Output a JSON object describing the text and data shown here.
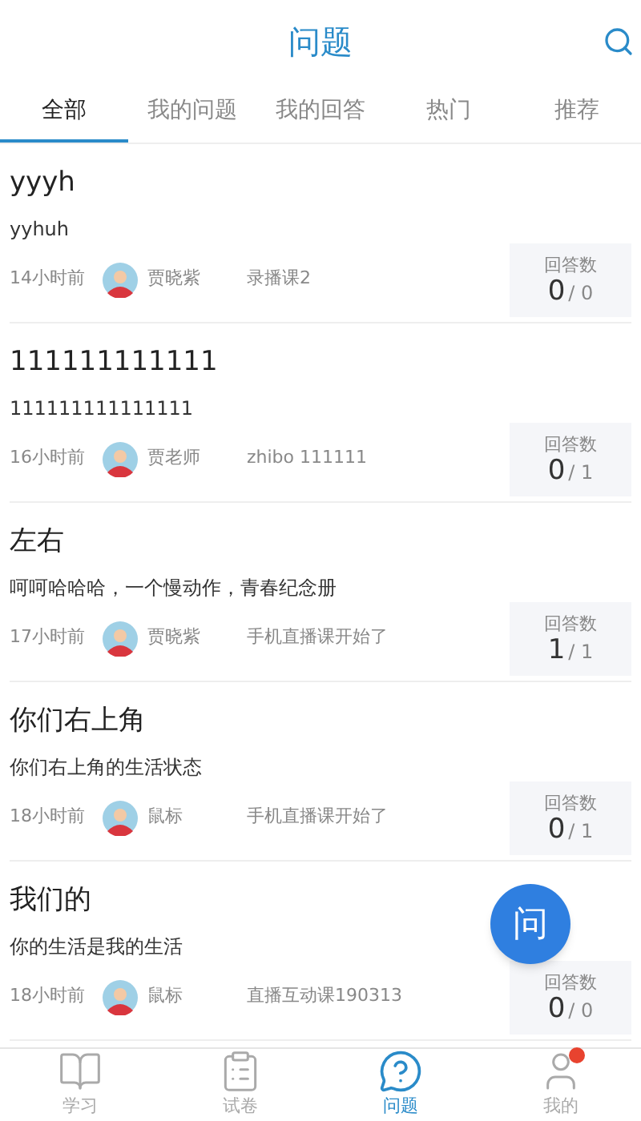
{
  "header": {
    "title": "问题"
  },
  "tabs": [
    {
      "label": "全部",
      "selected": true
    },
    {
      "label": "我的问题",
      "selected": false
    },
    {
      "label": "我的回答",
      "selected": false
    },
    {
      "label": "热门",
      "selected": false
    },
    {
      "label": "推荐",
      "selected": false
    }
  ],
  "questions": [
    {
      "title": "yyyh",
      "body": "yyhuh",
      "time": "14小时前",
      "author": "贾晓紫",
      "course": "录播课2",
      "count_label": "回答数",
      "answered": "0",
      "total": "/ 0"
    },
    {
      "title": "111111111111",
      "body": "111111111111111",
      "time": "16小时前",
      "author": "贾老师",
      "course": "zhibo 111111",
      "count_label": "回答数",
      "answered": "0",
      "total": "/ 1"
    },
    {
      "title": "左右",
      "body": "呵呵哈哈哈，一个慢动作，青春纪念册",
      "time": "17小时前",
      "author": "贾晓紫",
      "course": "手机直播课开始了",
      "count_label": "回答数",
      "answered": "1",
      "total": "/ 1"
    },
    {
      "title": "你们右上角",
      "body": "你们右上角的生活状态",
      "time": "18小时前",
      "author": "鼠标",
      "course": "手机直播课开始了",
      "count_label": "回答数",
      "answered": "0",
      "total": "/ 1"
    },
    {
      "title": "我们的",
      "body": "你的生活是我的生活",
      "time": "18小时前",
      "author": "鼠标",
      "course": "直播互动课190313",
      "count_label": "回答数",
      "answered": "0",
      "total": "/ 0"
    }
  ],
  "ask_button": {
    "label": "问"
  },
  "bottom_nav": [
    {
      "label": "学习",
      "kind": "book",
      "selected": false,
      "dot": false
    },
    {
      "label": "试卷",
      "kind": "paper",
      "selected": false,
      "dot": false
    },
    {
      "label": "问题",
      "kind": "question",
      "selected": true,
      "dot": false
    },
    {
      "label": "我的",
      "kind": "person",
      "selected": false,
      "dot": true
    }
  ]
}
